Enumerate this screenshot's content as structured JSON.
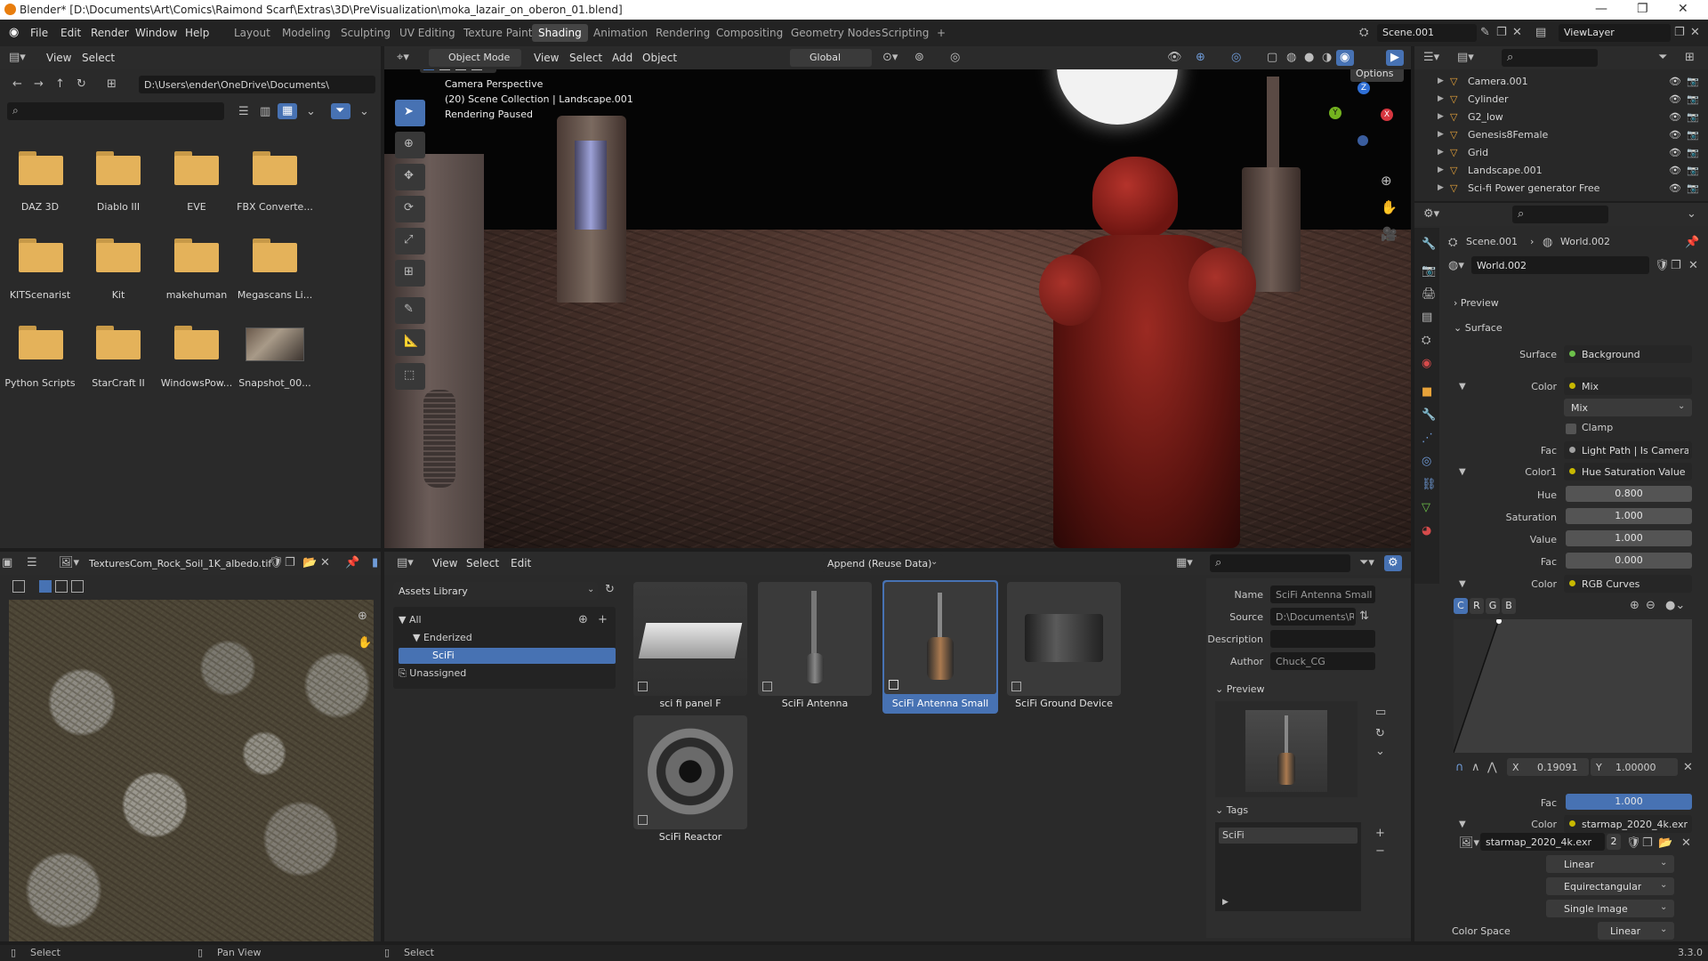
{
  "window": {
    "title": "Blender* [D:\\Documents\\Art\\Comics\\Raimond Scarf\\Extras\\3D\\PreVisualization\\moka_lazair_on_oberon_01.blend]",
    "minimize": "—",
    "maximize": "❐",
    "close": "✕"
  },
  "menu": {
    "items": [
      "File",
      "Edit",
      "Render",
      "Window",
      "Help"
    ],
    "workspaces": [
      "Layout",
      "Modeling",
      "Sculpting",
      "UV Editing",
      "Texture Paint",
      "Shading",
      "Animation",
      "Rendering",
      "Compositing",
      "Geometry Nodes",
      "Scripting",
      "+"
    ],
    "active_workspace": "Shading",
    "scene": "Scene.001",
    "view_layer": "ViewLayer"
  },
  "file_browser": {
    "menus": [
      "View",
      "Select"
    ],
    "path": "D:\\Users\\ender\\OneDrive\\Documents\\",
    "folders": [
      "DAZ 3D",
      "Diablo III",
      "EVE",
      "FBX Converte...",
      "KITScenarist",
      "Kit",
      "makehuman",
      "Megascans Li...",
      "Python Scripts",
      "StarCraft II",
      "WindowsPow..."
    ],
    "image_item": "Snapshot_00..."
  },
  "viewport": {
    "mode": "Object Mode",
    "menus": [
      "View",
      "Select",
      "Add",
      "Object"
    ],
    "orientation": "Global",
    "options_label": "Options",
    "overlay_lines": [
      "Camera Perspective",
      "(20) Scene Collection | Landscape.001",
      "Rendering Paused"
    ],
    "gizmo_axes": [
      "Z",
      "Y",
      "X"
    ]
  },
  "outliner": {
    "items": [
      {
        "name": "Camera.001",
        "icon_color": "#e8a33a"
      },
      {
        "name": "Cylinder",
        "icon_color": "#e8a33a"
      },
      {
        "name": "G2_low",
        "icon_color": "#e8a33a"
      },
      {
        "name": "Genesis8Female",
        "icon_color": "#e8a33a"
      },
      {
        "name": "Grid",
        "icon_color": "#e8a33a"
      },
      {
        "name": "Landscape.001",
        "icon_color": "#e8a33a"
      },
      {
        "name": "Sci-fi Power generator Free",
        "icon_color": "#e8a33a"
      }
    ]
  },
  "properties": {
    "breadcrumb_scene": "Scene.001",
    "breadcrumb_world": "World.002",
    "world_name": "World.002",
    "preview_label": "Preview",
    "surface_label": "Surface",
    "rows": {
      "surface": {
        "label": "Surface",
        "value": "Background"
      },
      "color1": {
        "label": "Color",
        "value": "Mix"
      },
      "mix_select": "Mix",
      "clamp": "Clamp",
      "fac1": {
        "label": "Fac",
        "value": "Light Path | Is Camera R"
      },
      "color1b": {
        "label": "Color1",
        "value": "Hue Saturation Value"
      },
      "hue": {
        "label": "Hue",
        "value": "0.800"
      },
      "saturation": {
        "label": "Saturation",
        "value": "1.000"
      },
      "value": {
        "label": "Value",
        "value": "1.000"
      },
      "fac2": {
        "label": "Fac",
        "value": "0.000"
      },
      "color2": {
        "label": "Color",
        "value": "RGB Curves"
      },
      "curve_channels": [
        "C",
        "R",
        "G",
        "B"
      ],
      "curve_x": {
        "label": "X",
        "value": "0.19091"
      },
      "curve_y": {
        "label": "Y",
        "value": "1.00000"
      },
      "fac3": {
        "label": "Fac",
        "value": "1.000"
      },
      "color3": {
        "label": "Color",
        "value": "starmap_2020_4k.exr"
      },
      "image_name": "starmap_2020_4k.exr",
      "image_users": "2",
      "interp": "Linear",
      "projection": "Equirectangular",
      "source": "Single Image",
      "color_space": {
        "label": "Color Space",
        "value": "Linear"
      }
    }
  },
  "image_editor": {
    "image_name": "TexturesCom_Rock_Soil_1K_albedo.tif"
  },
  "asset_browser": {
    "menus": [
      "View",
      "Select",
      "Edit"
    ],
    "import_mode": "Append (Reuse Data)",
    "library": "Assets Library",
    "tree": {
      "all": "All",
      "enderized": "Enderized",
      "scifi": "SciFi",
      "unassigned": "Unassigned"
    },
    "assets": [
      "sci fi panel F",
      "SciFi Antenna",
      "SciFi Antenna Small",
      "SciFi Ground Device",
      "SciFi Reactor"
    ],
    "selected_asset": "SciFi Antenna Small",
    "details": {
      "name": {
        "label": "Name",
        "value": "SciFi Antenna Small"
      },
      "source": {
        "label": "Source",
        "value": "D:\\Documents\\R..."
      },
      "description": {
        "label": "Description",
        "value": ""
      },
      "author": {
        "label": "Author",
        "value": "Chuck_CG"
      }
    },
    "preview_label": "Preview",
    "tags_label": "Tags",
    "tags": [
      "SciFi"
    ]
  },
  "statusbar": {
    "items": [
      "Select",
      "Pan View",
      "Select"
    ],
    "version": "3.3.0"
  },
  "colors": {
    "accent_blue": "#4772b3",
    "panel_bg": "#303030",
    "header_bg": "#2b2b2b",
    "folder": "#e4b25a"
  }
}
